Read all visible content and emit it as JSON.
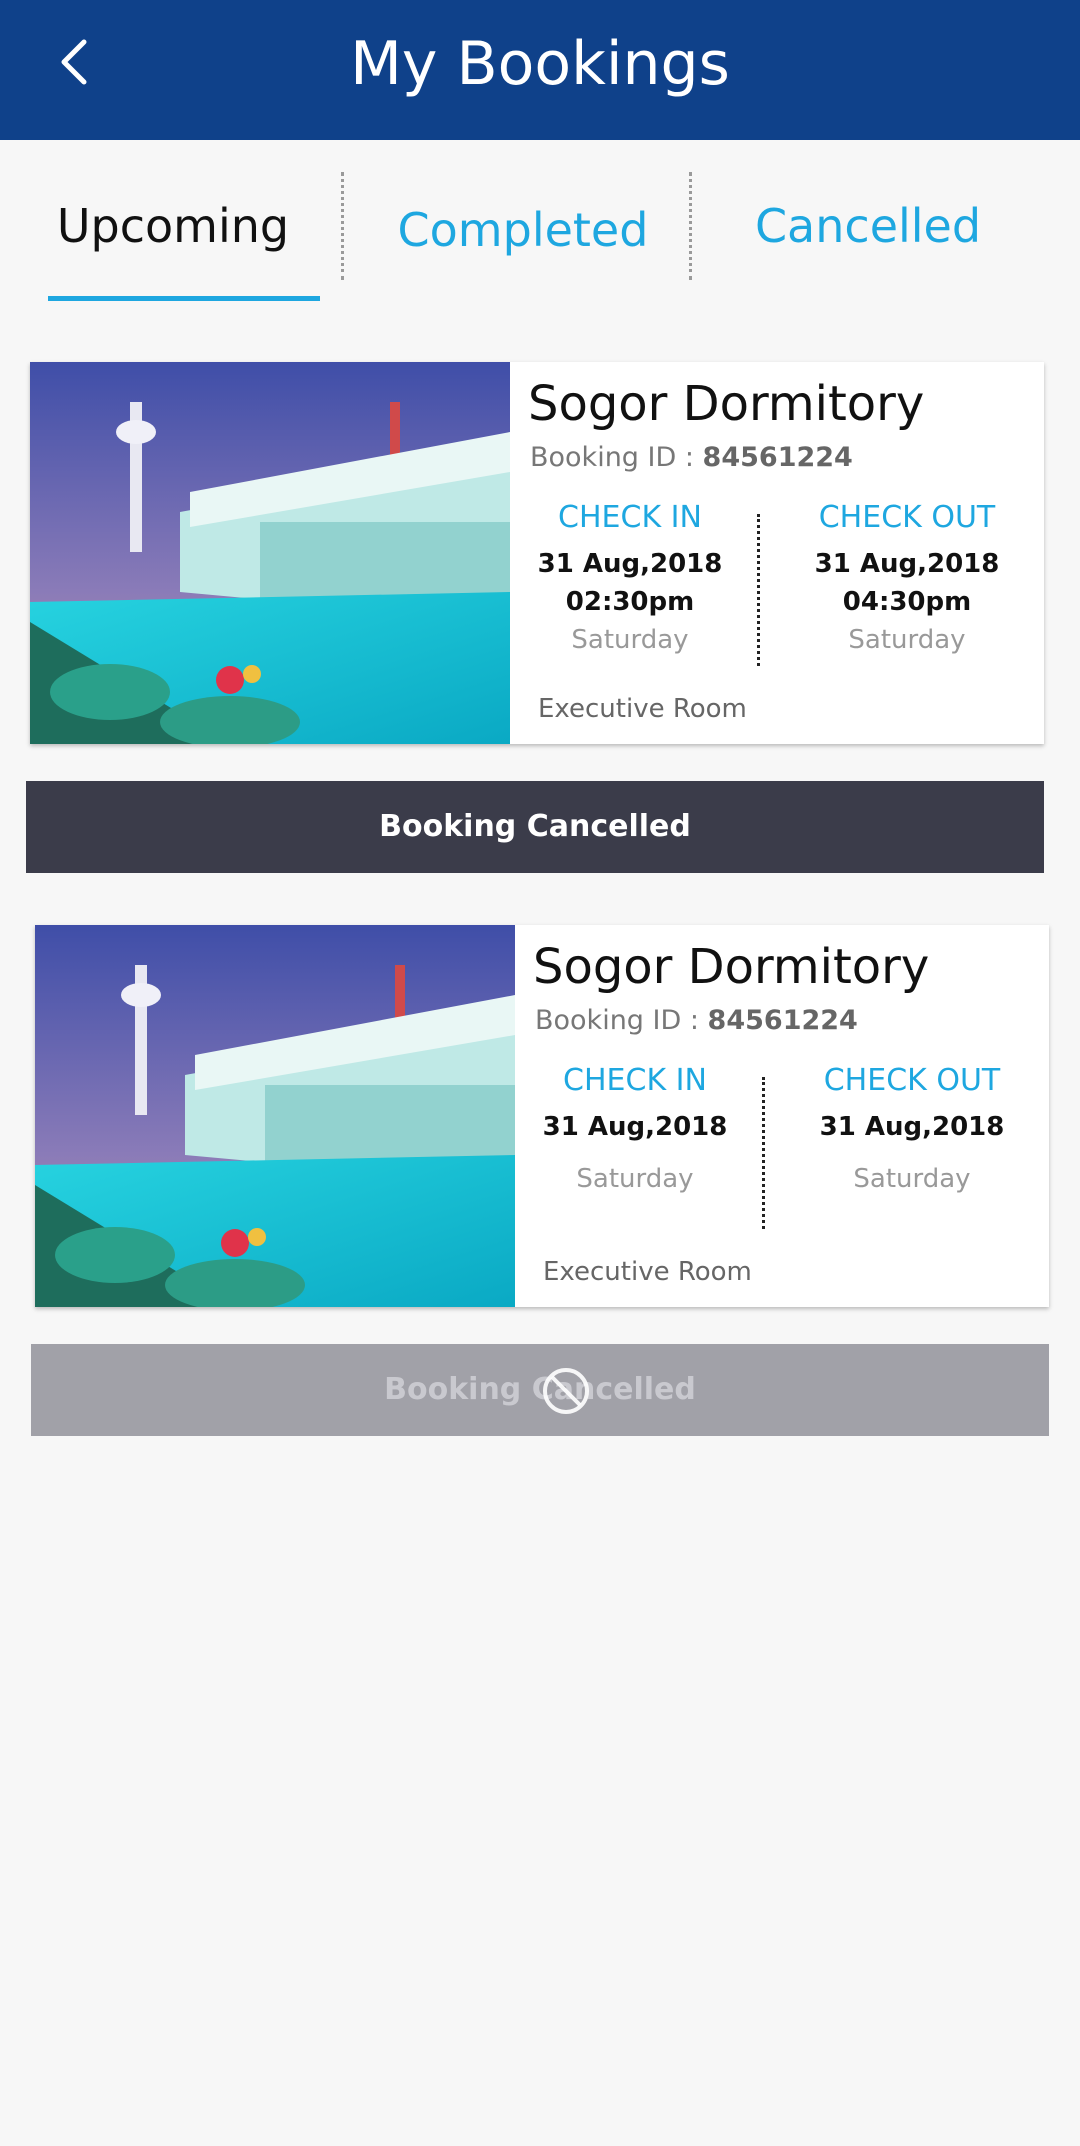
{
  "header": {
    "title": "My Bookings",
    "back_icon": "chevron-left-icon"
  },
  "tabs": [
    {
      "label": "Upcoming",
      "active": true
    },
    {
      "label": "Completed",
      "active": false
    },
    {
      "label": "Cancelled",
      "active": false
    }
  ],
  "bookings": [
    {
      "hotel_name": "Sogor Dormitory",
      "booking_id_label": "Booking ID : ",
      "booking_id": "84561224",
      "check_in": {
        "heading": "CHECK IN",
        "date": "31 Aug,2018",
        "time": "02:30pm",
        "day": "Saturday"
      },
      "check_out": {
        "heading": "CHECK OUT",
        "date": "31 Aug,2018",
        "time": "04:30pm",
        "day": "Saturday"
      },
      "room_type": "Executive Room",
      "action_label": "Booking Cancelled"
    },
    {
      "hotel_name": "Sogor Dormitory",
      "booking_id_label": "Booking ID : ",
      "booking_id": "84561224",
      "check_in": {
        "heading": "CHECK IN",
        "date": "31 Aug,2018",
        "day": "Saturday"
      },
      "check_out": {
        "heading": "CHECK OUT",
        "date": "31 Aug,2018",
        "day": "Saturday"
      },
      "room_type": "Executive Room",
      "action_label": "Booking Cancelled",
      "action_icon": "forbidden-icon"
    }
  ],
  "colors": {
    "header": "#0f418a",
    "accent": "#1ea7e0",
    "button_dark": "#3b3c4a",
    "button_disabled": "#a1a1a8"
  }
}
